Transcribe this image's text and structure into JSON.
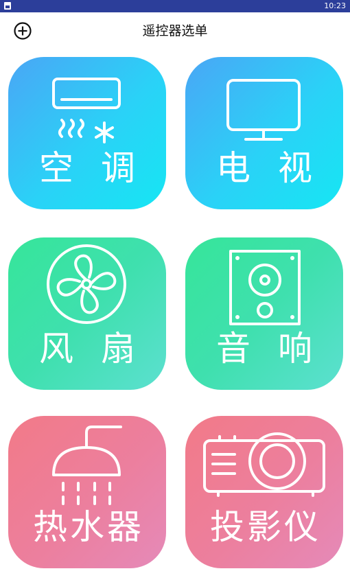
{
  "status_bar": {
    "time": "10:23"
  },
  "header": {
    "title": "遥控器选单",
    "add_icon": "plus-circle-icon"
  },
  "tiles": [
    {
      "label": "空调",
      "icon": "air-conditioner-icon",
      "color": "#2ad2f7"
    },
    {
      "label": "电视",
      "icon": "television-icon",
      "color": "#2ad2f7"
    },
    {
      "label": "风扇",
      "icon": "fan-icon",
      "color": "#3fe0ae"
    },
    {
      "label": "音响",
      "icon": "speaker-icon",
      "color": "#3fe0ae"
    },
    {
      "label": "热水器",
      "icon": "shower-head-icon",
      "color": "#ec7f9e"
    },
    {
      "label": "投影仪",
      "icon": "projector-icon",
      "color": "#ec7f9e"
    }
  ]
}
